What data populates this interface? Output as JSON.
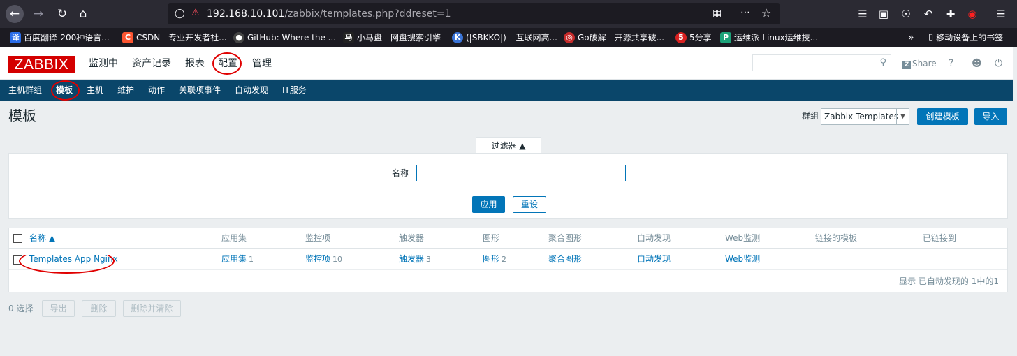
{
  "browser": {
    "url_main": "192.168.10.101",
    "url_rest": "/zabbix/templates.php?ddreset=1",
    "bookmarks": [
      {
        "label": "百度翻译-200种语言...",
        "icon_text": "译",
        "color": "#2b6de8"
      },
      {
        "label": "CSDN - 专业开发者社...",
        "icon_text": "C",
        "color": "#fc5531"
      },
      {
        "label": "GitHub: Where the ...",
        "icon_text": "●",
        "color": "#444444"
      },
      {
        "label": "小马盘 - 网盘搜索引擎",
        "icon_text": "马",
        "color": "#222222"
      },
      {
        "label": "(|SBKKO|) – 互联网高...",
        "icon_text": "K",
        "color": "#3a74d8"
      },
      {
        "label": "Go破解 - 开源共享破...",
        "icon_text": "◎",
        "color": "#c52a2a"
      },
      {
        "label": "5分享",
        "icon_text": "5",
        "color": "#d82020"
      },
      {
        "label": "运维派-Linux运维技...",
        "icon_text": "P",
        "color": "#1da37a"
      }
    ],
    "mobile_bookmarks": "移动设备上的书签"
  },
  "header": {
    "logo": "ZABBIX",
    "menu": [
      "监测中",
      "资产记录",
      "报表",
      "配置",
      "管理"
    ],
    "share_label": "Share",
    "help_label": "?"
  },
  "submenu": [
    "主机群组",
    "模板",
    "主机",
    "维护",
    "动作",
    "关联项事件",
    "自动发现",
    "IT服务"
  ],
  "page": {
    "title": "模板",
    "group_label": "群组",
    "group_value": "Zabbix Templates",
    "create_button": "创建模板",
    "import_button": "导入"
  },
  "filter": {
    "tab_label": "过滤器 ▲",
    "name_label": "名称",
    "name_value": "",
    "apply_button": "应用",
    "reset_button": "重设"
  },
  "table": {
    "headers": [
      "名称 ▲",
      "应用集",
      "监控项",
      "触发器",
      "图形",
      "聚合图形",
      "自动发现",
      "Web监测",
      "链接的模板",
      "已链接到"
    ],
    "rows": [
      {
        "name": "Templates App Nginx",
        "applications": "应用集",
        "applications_count": "1",
        "items": "监控项",
        "items_count": "10",
        "triggers": "触发器",
        "triggers_count": "3",
        "graphs": "图形",
        "graphs_count": "2",
        "screens": "聚合图形",
        "discovery": "自动发现",
        "web": "Web监测"
      }
    ],
    "footer": "显示 已自动发现的 1中的1"
  },
  "actions": {
    "selected_count": "0 选择",
    "export_button": "导出",
    "delete_button": "删除",
    "delete_clear_button": "删除并清除"
  }
}
